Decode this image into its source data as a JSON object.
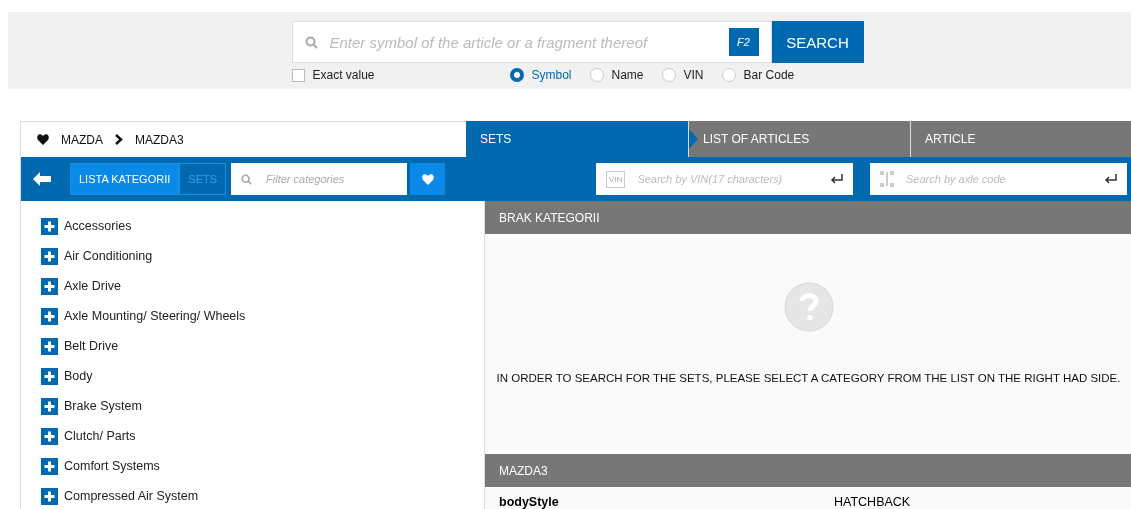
{
  "search": {
    "placeholder": "Enter symbol of the article or a fragment thereof",
    "shortcut": "F2",
    "button": "SEARCH",
    "exact_value": {
      "label": "Exact value",
      "checked": false
    },
    "modes": [
      {
        "label": "Symbol",
        "selected": true
      },
      {
        "label": "Name",
        "selected": false
      },
      {
        "label": "VIN",
        "selected": false
      },
      {
        "label": "Bar Code",
        "selected": false
      }
    ]
  },
  "breadcrumb": [
    "MAZDA",
    "MAZDA3"
  ],
  "steps": [
    {
      "label": "SETS",
      "selected": true
    },
    {
      "label": "LIST OF ARTICLES",
      "selected": false
    },
    {
      "label": "ARTICLE",
      "selected": false
    }
  ],
  "toolbar": {
    "toggles": [
      {
        "label": "LISTA KATEGORII",
        "selected": true
      },
      {
        "label": "SETS",
        "selected": false
      }
    ],
    "filter_placeholder": "Filter categories",
    "vin_icon_label": "VIN",
    "vin_placeholder": "Search by VIN(17 characters)",
    "axle_placeholder": "Search by axle code"
  },
  "categories": [
    "Accessories",
    "Air Conditioning",
    "Axle Drive",
    "Axle Mounting/ Steering/ Wheels",
    "Belt Drive",
    "Body",
    "Brake System",
    "Clutch/ Parts",
    "Comfort Systems",
    "Compressed Air System"
  ],
  "sets_panel": {
    "title": "BRAK KATEGORII",
    "message": "IN ORDER TO SEARCH FOR THE SETS, PLEASE SELECT A CATEGORY FROM THE LIST ON THE RIGHT HAD SIDE."
  },
  "vehicle_panel": {
    "title": "MAZDA3",
    "rows": [
      {
        "key": "bodyStyle",
        "value": "HATCHBACK"
      }
    ]
  }
}
